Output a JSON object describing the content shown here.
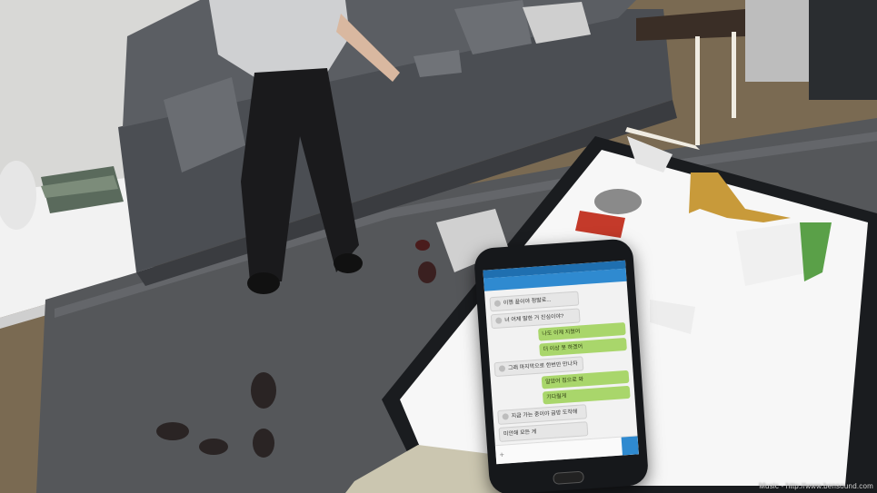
{
  "phone": {
    "chat_lines": [
      {
        "side": "in",
        "text": "이젠 끝이야 정말로..."
      },
      {
        "side": "in",
        "text": "너 어제 말한 거 진심이야?"
      },
      {
        "side": "out",
        "text": "나도 이제 지쳤어"
      },
      {
        "side": "out",
        "text": "더 이상 못 하겠어"
      },
      {
        "side": "in",
        "text": "그래 마지막으로 한번만 만나자"
      },
      {
        "side": "out",
        "text": "알았어 집으로 와"
      },
      {
        "side": "out",
        "text": "기다릴게"
      },
      {
        "side": "in",
        "text": "지금 가는 중이야 금방 도착해"
      },
      {
        "side": "in",
        "text": "미안해 모든 게"
      }
    ],
    "input_placeholder": "",
    "header_label": "",
    "status_time": ""
  },
  "overlay": {
    "music_credit": "Music - http://www.bensound.com"
  }
}
